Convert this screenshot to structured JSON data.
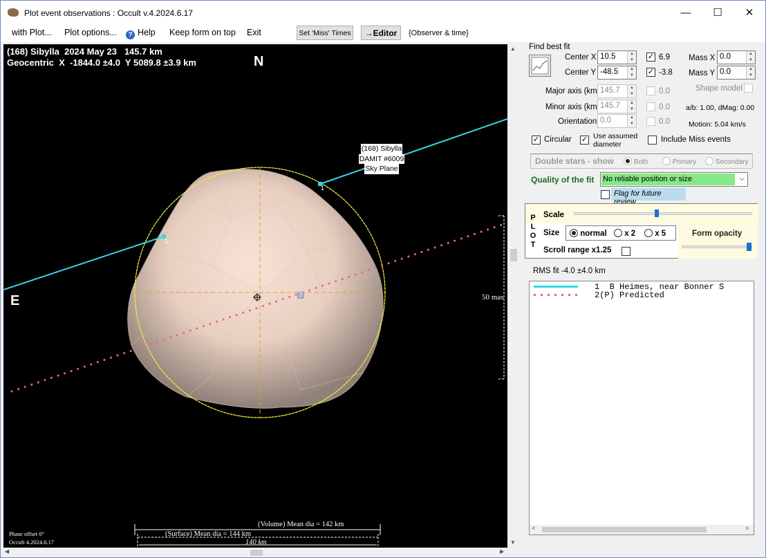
{
  "window": {
    "title": "Plot event observations : Occult v.4.2024.6.17",
    "minimize_glyph": "—",
    "maximize_glyph": "☐",
    "close_glyph": "✕"
  },
  "menu": {
    "with_plot": "with Plot...",
    "plot_options": "Plot options...",
    "help": "Help",
    "help_glyph": "?",
    "keep_on_top": "Keep form on top",
    "exit": "Exit",
    "set_miss_times": "Set 'Miss' Times",
    "editor": "→Editor",
    "observer_time": "{Observer & time}"
  },
  "plot": {
    "header_line1": "(168) Sibylla  2024 May 23   145.7 km",
    "header_line2": "Geocentric  X  -1844.0 ±4.0  Y 5089.8 ±3.9 km",
    "north": "N",
    "east": "E",
    "label_line1": "(168) Sibylla",
    "label_line2": "DAMIT #6009",
    "label_line3": "Sky Plane",
    "chord_number": "1",
    "predicted_marker": "2",
    "scale_50mas": "50 mas",
    "volume_mean_dia": "(Volume) Mean dia = 142 km",
    "surface_mean_dia": "(Surface) Mean dia = 144 km",
    "scale_km": "140 km",
    "phase_offset": "Phase offset 0°",
    "version": "Occult 4.2024.6.17",
    "colors": {
      "chord": "#33d9e6",
      "limb": "#f2ea3a",
      "predicted": "#e8609a",
      "axis": "#e0a030"
    }
  },
  "panel": {
    "find_best_fit": "Find best fit",
    "center_x_label": "Center X",
    "center_x_value": "10.5",
    "center_y_label": "Center Y",
    "center_y_value": "-48.5",
    "cx_fit_value": "6.9",
    "cy_fit_value": "-3.8",
    "mass_x_label": "Mass X",
    "mass_x_value": "0.0",
    "mass_y_label": "Mass Y",
    "mass_y_value": "0.0",
    "major_axis_label": "Major axis (km)",
    "major_axis_value": "145.7",
    "major_fit_value": "0.0",
    "minor_axis_label": "Minor axis (km)",
    "minor_axis_value": "145.7",
    "minor_fit_value": "0.0",
    "orientation_label": "Orientation",
    "orientation_value": "0.0",
    "orientation_fit_value": "0.0",
    "shape_model_label": "Shape model",
    "ab_dmag": "a/b: 1.00, dMag: 0.00",
    "motion": "Motion: 5.04 km/s",
    "circular_label": "Circular",
    "use_assumed_line1": "Use assumed",
    "use_assumed_line2": "diameter",
    "include_miss_label": "Include Miss events",
    "double_stars_label": "Double stars - show",
    "both_label": "Both",
    "primary_label": "Primary",
    "secondary_label": "Secondary",
    "quality_label": "Quality of the fit",
    "quality_value": "No reliable position or size",
    "flag_review_label": "Flag for future review",
    "plot_vertical": [
      "P",
      "L",
      "O",
      "T"
    ],
    "scale_label": "Scale",
    "size_label": "Size",
    "size_normal": "normal",
    "size_x2": "x 2",
    "size_x5": "x 5",
    "form_opacity_label": "Form opacity",
    "scroll_range_label": "Scroll range x1.25",
    "rms_fit": "RMS fit -4.0 ±4.0 km",
    "check_glyph": "✓"
  },
  "legend": {
    "rows": [
      {
        "id": "1",
        "text": "  B Heimes, near Bonner S"
      },
      {
        "id": "2(P)",
        "text": " Predicted"
      }
    ]
  }
}
